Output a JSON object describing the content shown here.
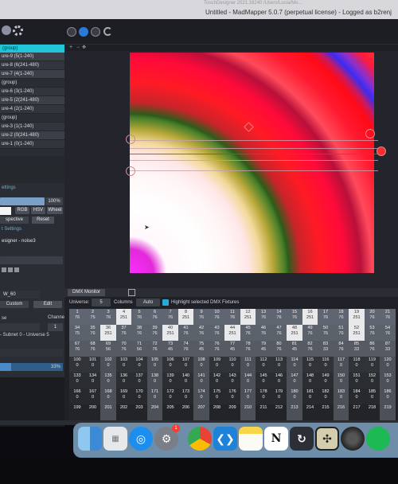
{
  "window": {
    "dim_path": "TouchDesigner 2021.16240 /Users/Lucia/Mo...",
    "title": "Untitled - MadMapper 5.0.7 (perpetual license) - Logged as b2renj"
  },
  "layers": {
    "header": "(group)",
    "items": [
      "ure-9 (5(1-240)",
      "ure-8 (6(241-480)",
      "ure-7 (4(1-240)",
      "(group)",
      "ure-6 (3(1-240)",
      "ure-5 (2(241-480)",
      "ure-4 (2(1-240)",
      "(group)",
      "ure-3 (1(1-240)",
      "ure-2 (0(241-480)",
      "ure-1 (0(1-240)"
    ]
  },
  "left_settings": {
    "settings_label": "ettings",
    "opacity_value": "100%",
    "rgb": "RGB",
    "hsv": "HSV",
    "wheel": "Wheel",
    "perspective": "spective",
    "reset": "Reset",
    "t_settings": "t Settings",
    "source": "esigner - noise3",
    "fixture_name": "W_60",
    "custom": "Custom",
    "edit": "Edit",
    "se_label": "se",
    "channel_label": "Channel",
    "channel_value": "1",
    "universe_line": "- Subnet 0 - Universe 5",
    "bottom_pct": "33%"
  },
  "dmx": {
    "tab_label": "DMX Monitor",
    "universe_label": "Universe:",
    "universe_value": "5",
    "columns_label": "Columns",
    "columns_value": "Auto",
    "highlight_label": "Highlight selected DMX Fixtures",
    "rows": [
      {
        "ch": [
          "1",
          "2",
          "3",
          "4",
          "5",
          "6",
          "7",
          "8",
          "9",
          "10",
          "11",
          "12",
          "13",
          "14",
          "15",
          "16",
          "17",
          "18",
          "19",
          "20",
          "21"
        ],
        "val": [
          "76",
          "75",
          "76",
          "251",
          "76",
          "76",
          "76",
          "251",
          "76",
          "76",
          "76",
          "251",
          "76",
          "76",
          "76",
          "251",
          "76",
          "76",
          "251",
          "76",
          "76"
        ]
      },
      {
        "ch": [
          "34",
          "35",
          "36",
          "37",
          "38",
          "39",
          "40",
          "41",
          "42",
          "43",
          "44",
          "45",
          "46",
          "47",
          "48",
          "49",
          "50",
          "51",
          "52",
          "53",
          "54"
        ],
        "val": [
          "75",
          "76",
          "251",
          "76",
          "76",
          "76",
          "251",
          "76",
          "76",
          "76",
          "251",
          "76",
          "76",
          "76",
          "251",
          "76",
          "76",
          "76",
          "251",
          "76",
          "76"
        ]
      },
      {
        "ch": [
          "67",
          "68",
          "69",
          "70",
          "71",
          "72",
          "73",
          "74",
          "75",
          "76",
          "77",
          "78",
          "79",
          "80",
          "81",
          "82",
          "83",
          "84",
          "85",
          "86",
          "87"
        ],
        "val": [
          "76",
          "76",
          "56",
          "76",
          "56",
          "76",
          "45",
          "76",
          "45",
          "76",
          "45",
          "76",
          "45",
          "76",
          "45",
          "76",
          "33",
          "76",
          "33",
          "76",
          "33"
        ]
      },
      {
        "ch": [
          "100",
          "101",
          "102",
          "103",
          "104",
          "105",
          "106",
          "107",
          "108",
          "109",
          "110",
          "111",
          "112",
          "113",
          "114",
          "115",
          "116",
          "117",
          "118",
          "119",
          "120"
        ],
        "val": [
          "0",
          "0",
          "0",
          "0",
          "0",
          "0",
          "0",
          "0",
          "0",
          "0",
          "0",
          "0",
          "0",
          "0",
          "0",
          "0",
          "0",
          "0",
          "0",
          "0",
          "0"
        ]
      },
      {
        "ch": [
          "133",
          "134",
          "135",
          "136",
          "137",
          "138",
          "139",
          "140",
          "141",
          "142",
          "143",
          "144",
          "145",
          "146",
          "147",
          "148",
          "149",
          "150",
          "151",
          "152",
          "153"
        ],
        "val": [
          "0",
          "0",
          "0",
          "0",
          "0",
          "0",
          "0",
          "0",
          "0",
          "0",
          "0",
          "0",
          "0",
          "0",
          "0",
          "0",
          "0",
          "0",
          "0",
          "0",
          "0"
        ]
      },
      {
        "ch": [
          "166",
          "167",
          "168",
          "169",
          "170",
          "171",
          "172",
          "173",
          "174",
          "175",
          "176",
          "177",
          "178",
          "179",
          "180",
          "181",
          "182",
          "183",
          "184",
          "185",
          "186"
        ],
        "val": [
          "0",
          "0",
          "0",
          "0",
          "0",
          "0",
          "0",
          "0",
          "0",
          "0",
          "0",
          "0",
          "0",
          "0",
          "0",
          "0",
          "0",
          "0",
          "0",
          "0",
          "0"
        ]
      },
      {
        "ch": [
          "199",
          "200",
          "201",
          "202",
          "203",
          "204",
          "205",
          "206",
          "207",
          "208",
          "209",
          "210",
          "211",
          "212",
          "213",
          "214",
          "215",
          "216",
          "217",
          "218",
          "219"
        ],
        "val": [
          "",
          "",
          "",
          "",
          "",
          "",
          "",
          "",
          "",
          "",
          "",
          "",
          "",
          "",
          "",
          "",
          "",
          "",
          "",
          "",
          ""
        ]
      }
    ]
  },
  "dock": {
    "apps": [
      "finder-icon",
      "launchpad-icon",
      "safari-icon",
      "settings-icon",
      "chrome-icon",
      "vscode-icon",
      "notes-icon",
      "notion-icon",
      "touchdesigner-icon",
      "madmapper-icon",
      "resolve-icon",
      "spotify-icon"
    ],
    "settings_badge": "1",
    "notion_letter": "N"
  }
}
